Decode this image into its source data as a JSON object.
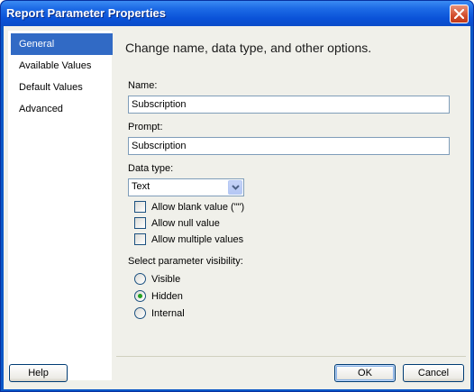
{
  "window": {
    "title": "Report Parameter Properties"
  },
  "sidebar": {
    "items": [
      {
        "label": "General",
        "selected": true
      },
      {
        "label": "Available Values",
        "selected": false
      },
      {
        "label": "Default Values",
        "selected": false
      },
      {
        "label": "Advanced",
        "selected": false
      }
    ]
  },
  "main": {
    "heading": "Change name, data type, and other options.",
    "name_label": "Name:",
    "name_value": "Subscription",
    "prompt_label": "Prompt:",
    "prompt_value": "Subscription",
    "datatype_label": "Data type:",
    "datatype_value": "Text",
    "checkboxes": [
      {
        "label": "Allow blank value (\"\")",
        "checked": false
      },
      {
        "label": "Allow null value",
        "checked": false
      },
      {
        "label": "Allow multiple values",
        "checked": false
      }
    ],
    "visibility_label": "Select parameter visibility:",
    "visibility_options": [
      {
        "label": "Visible",
        "checked": false
      },
      {
        "label": "Hidden",
        "checked": true
      },
      {
        "label": "Internal",
        "checked": false
      }
    ]
  },
  "footer": {
    "help_label": "Help",
    "ok_label": "OK",
    "cancel_label": "Cancel"
  },
  "colors": {
    "titlebar": "#0a52d8",
    "selection": "#316ac5",
    "dialog_bg": "#f0f0ea",
    "radio_dot": "#21a121"
  }
}
